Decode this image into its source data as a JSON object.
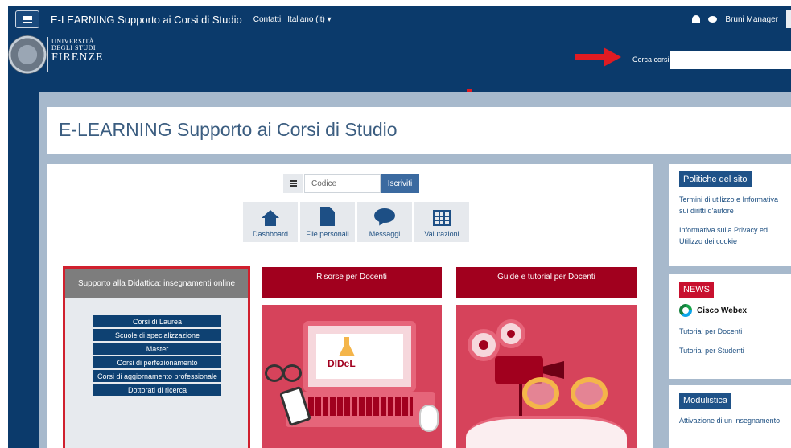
{
  "navbar": {
    "site_name": "E-LEARNING Supporto ai Corsi di Studio",
    "contacts_label": "Contatti",
    "language_label": "Italiano (it) ▾",
    "user_name": "Bruni Manager"
  },
  "header": {
    "logo_line1": "UNIVERSITÀ",
    "logo_line2": "DEGLI STUDI",
    "logo_line3": "FIRENZE",
    "search_label": "Cerca corsi",
    "search_value": ""
  },
  "page": {
    "title": "E-LEARNING Supporto ai Corsi di Studio"
  },
  "enrol": {
    "code_placeholder": "Codice",
    "submit_label": "Iscriviti"
  },
  "quick_links": [
    {
      "label": "Dashboard",
      "icon": "home-icon"
    },
    {
      "label": "File personali",
      "icon": "file-icon"
    },
    {
      "label": "Messaggi",
      "icon": "message-icon"
    },
    {
      "label": "Valutazioni",
      "icon": "grades-icon"
    }
  ],
  "didattica": {
    "title": "Supporto alla Didattica: insegnamenti online",
    "courses": [
      "Corsi di Laurea",
      "Scuole di specializzazione",
      "Master",
      "Corsi di perfezionamento",
      "Corsi di aggiornamento professionale",
      "Dottorati di ricerca"
    ]
  },
  "tiles": {
    "risorse_title": "Risorse per Docenti",
    "risorse_logo": "DIDeL",
    "guide_title": "Guide e tutorial per Docenti"
  },
  "sidebar": {
    "policies": {
      "title": "Politiche del sito",
      "links": [
        "Termini di utilizzo e Informativa sui diritti d'autore",
        "Informativa sulla Privacy ed Utilizzo dei cookie"
      ]
    },
    "news": {
      "title": "NEWS",
      "webex_label": "Cisco Webex",
      "links": [
        "Tutorial per Docenti",
        "Tutorial per Studenti"
      ]
    },
    "forms": {
      "title": "Modulistica",
      "links": [
        "Attivazione di un insegnamento"
      ]
    }
  },
  "colors": {
    "brand_navy": "#0b3a6b",
    "accent_red": "#d0202e",
    "tile_red": "#a1001e",
    "news_red": "#c8102e",
    "link_blue": "#1c4e80"
  }
}
